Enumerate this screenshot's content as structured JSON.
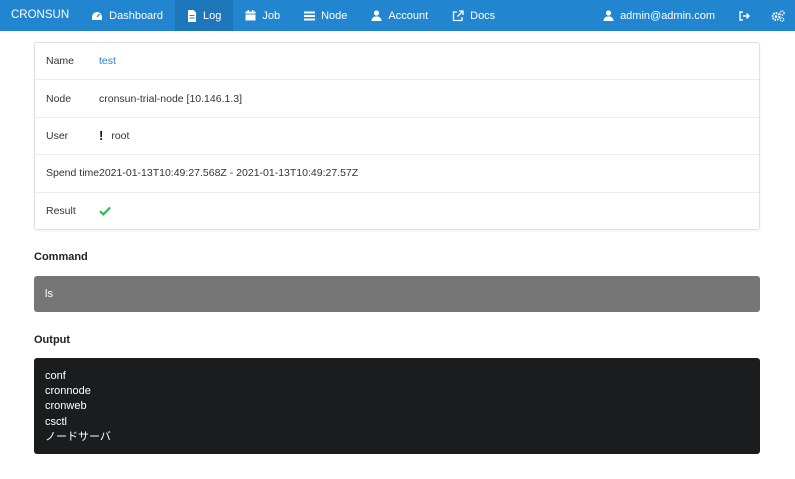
{
  "nav": {
    "brand": "CRONSUN",
    "items": [
      {
        "label": "Dashboard",
        "icon": "dashboard-icon"
      },
      {
        "label": "Log",
        "icon": "file-icon"
      },
      {
        "label": "Job",
        "icon": "calendar-icon"
      },
      {
        "label": "Node",
        "icon": "list-icon"
      },
      {
        "label": "Account",
        "icon": "user-icon"
      },
      {
        "label": "Docs",
        "icon": "external-link-icon"
      }
    ],
    "active": "Log",
    "user": "admin@admin.com",
    "logout_icon": "sign-out-icon",
    "settings_icon": "cogs-icon"
  },
  "detail": {
    "name_label": "Name",
    "name_value": "test",
    "node_label": "Node",
    "node_value": "cronsun-trial-node [10.146.1.3]",
    "user_label": "User",
    "user_value": "root",
    "spend_label": "Spend time",
    "spend_value": "2021-01-13T10:49:27.568Z - 2021-01-13T10:49:27.57Z",
    "result_label": "Result",
    "result_icon": "check-icon"
  },
  "command": {
    "title": "Command",
    "text": "ls"
  },
  "output": {
    "title": "Output",
    "lines": [
      "conf",
      "cronnode",
      "cronweb",
      "csctl",
      "ノードサーバ"
    ]
  },
  "colors": {
    "nav_bg": "#2185d0",
    "link": "#2185d0",
    "success": "#21ba45",
    "command_bg": "#767676",
    "output_bg": "#1b1c1d"
  }
}
